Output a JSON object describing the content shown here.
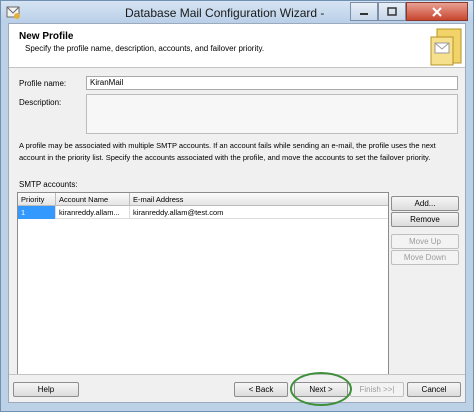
{
  "window": {
    "title": "Database Mail Configuration Wizard - "
  },
  "header": {
    "title": "New Profile",
    "subtitle": "Specify the profile name, description, accounts, and failover priority."
  },
  "form": {
    "profile_name_label": "Profile name:",
    "profile_name_value": "KiranMail",
    "description_label": "Description:",
    "description_value": ""
  },
  "info_text": "A profile may be associated with multiple SMTP accounts. If an account fails while sending an e-mail, the profile uses the next account in the priority list. Specify the accounts associated with the profile, and move the accounts to set the failover priority.",
  "smtp": {
    "label": "SMTP accounts:",
    "columns": [
      "Priority",
      "Account Name",
      "E-mail Address"
    ],
    "rows": [
      {
        "priority": "1",
        "account_name": "kiranreddy.allam...",
        "email": "kiranreddy.allam@test.com"
      }
    ],
    "buttons": {
      "add": "Add...",
      "remove": "Remove",
      "move_up": "Move Up",
      "move_down": "Move Down"
    }
  },
  "footer": {
    "help": "Help",
    "back": "< Back",
    "next": "Next >",
    "finish": "Finish >>|",
    "cancel": "Cancel"
  },
  "colors": {
    "selection": "#3399ff",
    "highlight_ring": "#3f8f3a"
  }
}
